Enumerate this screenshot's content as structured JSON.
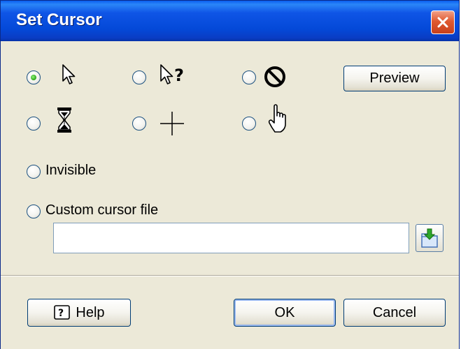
{
  "window": {
    "title": "Set Cursor"
  },
  "cursors": [
    {
      "name": "arrow-cursor",
      "selected": true
    },
    {
      "name": "help-cursor",
      "selected": false
    },
    {
      "name": "not-allowed-cursor",
      "selected": false
    },
    {
      "name": "hourglass-cursor",
      "selected": false
    },
    {
      "name": "crosshair-cursor",
      "selected": false
    },
    {
      "name": "hand-cursor",
      "selected": false
    }
  ],
  "buttons": {
    "preview": "Preview",
    "help": "Help",
    "ok": "OK",
    "cancel": "Cancel"
  },
  "options": {
    "invisible": "Invisible",
    "custom": "Custom cursor file"
  },
  "custom_file": {
    "value": ""
  },
  "colors": {
    "titlebar": "#0a48d8",
    "face": "#ece9d8",
    "close": "#e05a30",
    "radio_dot": "#2aa516"
  }
}
